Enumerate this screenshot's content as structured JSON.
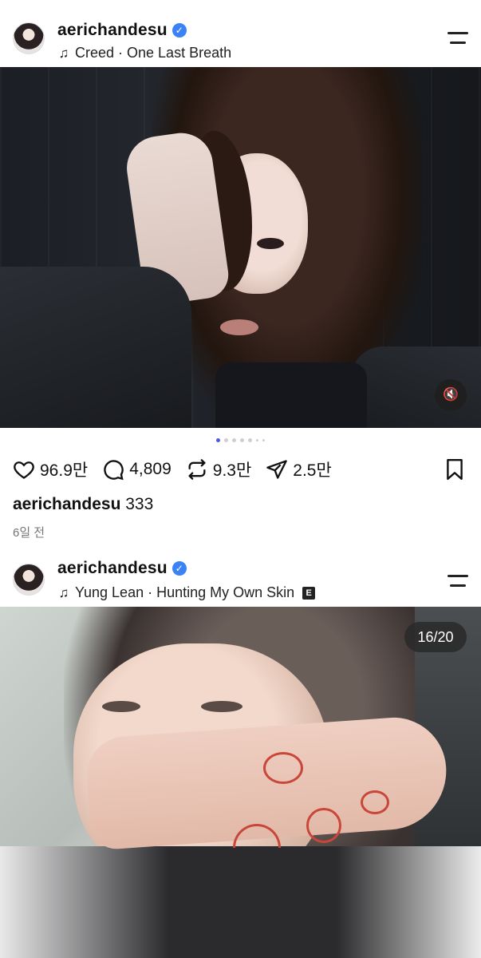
{
  "posts": [
    {
      "username": "aerichandesu",
      "verified": true,
      "music": {
        "artist": "Creed",
        "song": "One Last Breath",
        "line": "Creed · One Last Breath",
        "explicit": false
      },
      "media": {
        "icon": "mute-icon",
        "carousel_count": 7,
        "carousel_active": 1
      },
      "actions": {
        "likes": "96.9만",
        "comments": "4,809",
        "reposts": "9.3만",
        "shares": "2.5만"
      },
      "caption": {
        "user": "aerichandesu",
        "text": "333"
      },
      "time_ago": "6일 전"
    },
    {
      "username": "aerichandesu",
      "verified": true,
      "music": {
        "artist": "Yung Lean",
        "song": "Hunting My Own Skin",
        "line": "Yung Lean · Hunting My Own Skin",
        "explicit": true,
        "explicit_label": "E"
      },
      "media": {
        "counter": "16/20"
      }
    }
  ],
  "icons": {
    "like": "heart-icon",
    "comment": "comment-icon",
    "repost": "repost-icon",
    "share": "send-icon",
    "bookmark": "bookmark-icon",
    "menu": "menu-icon",
    "music": "music-note-icon",
    "verified": "verified-badge-icon"
  },
  "colors": {
    "verified": "#3b82f6",
    "carousel_active": "#4a5adf",
    "henna": "#c8463a"
  }
}
